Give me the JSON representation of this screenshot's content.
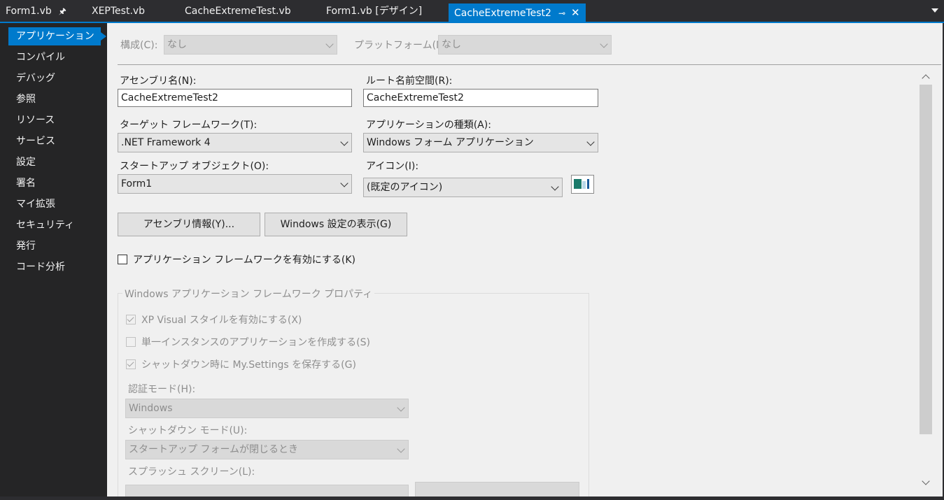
{
  "tabs": [
    {
      "label": "Form1.vb",
      "pinned": true
    },
    {
      "label": "XEPTest.vb"
    },
    {
      "label": "CacheExtremeTest.vb"
    },
    {
      "label": "Form1.vb [デザイン]"
    },
    {
      "label": "CacheExtremeTest2",
      "active": true
    }
  ],
  "sidebar": {
    "items": [
      {
        "label": "アプリケーション"
      },
      {
        "label": "コンパイル"
      },
      {
        "label": "デバッグ"
      },
      {
        "label": "参照"
      },
      {
        "label": "リソース"
      },
      {
        "label": "サービス"
      },
      {
        "label": "設定"
      },
      {
        "label": "署名"
      },
      {
        "label": "マイ拡張"
      },
      {
        "label": "セキュリティ"
      },
      {
        "label": "発行"
      },
      {
        "label": "コード分析"
      }
    ]
  },
  "header": {
    "config_label": "構成(C):",
    "config_value": "なし",
    "platform_label": "プラットフォーム(M):",
    "platform_value": "なし"
  },
  "form": {
    "assembly_name_label": "アセンブリ名(N):",
    "assembly_name_value": "CacheExtremeTest2",
    "root_ns_label": "ルート名前空間(R):",
    "root_ns_value": "CacheExtremeTest2",
    "target_fw_label": "ターゲット フレームワーク(T):",
    "target_fw_value": ".NET Framework 4",
    "app_type_label": "アプリケーションの種類(A):",
    "app_type_value": "Windows フォーム アプリケーション",
    "startup_label": "スタートアップ オブジェクト(O):",
    "startup_value": "Form1",
    "icon_label": "アイコン(I):",
    "icon_value": "(既定のアイコン)",
    "assembly_info_button": "アセンブリ情報(Y)...",
    "windows_settings_button": "Windows 設定の表示(G)",
    "enable_fw_checkbox": "アプリケーション フレームワークを有効にする(K)"
  },
  "framework_group": {
    "title": "Windows アプリケーション フレームワーク プロパティ",
    "xp_visual": "XP Visual スタイルを有効にする(X)",
    "single_instance": "単一インスタンスのアプリケーションを作成する(S)",
    "save_settings": "シャットダウン時に My.Settings を保存する(G)",
    "auth_mode_label": "認証モード(H):",
    "auth_mode_value": "Windows",
    "shutdown_mode_label": "シャットダウン モード(U):",
    "shutdown_mode_value": "スタートアップ フォームが閉じるとき",
    "splash_label": "スプラッシュ スクリーン(L):"
  },
  "colors": {
    "accent": "#007acc",
    "dark_bg": "#252526",
    "panel_bg": "#f0f0f0"
  }
}
